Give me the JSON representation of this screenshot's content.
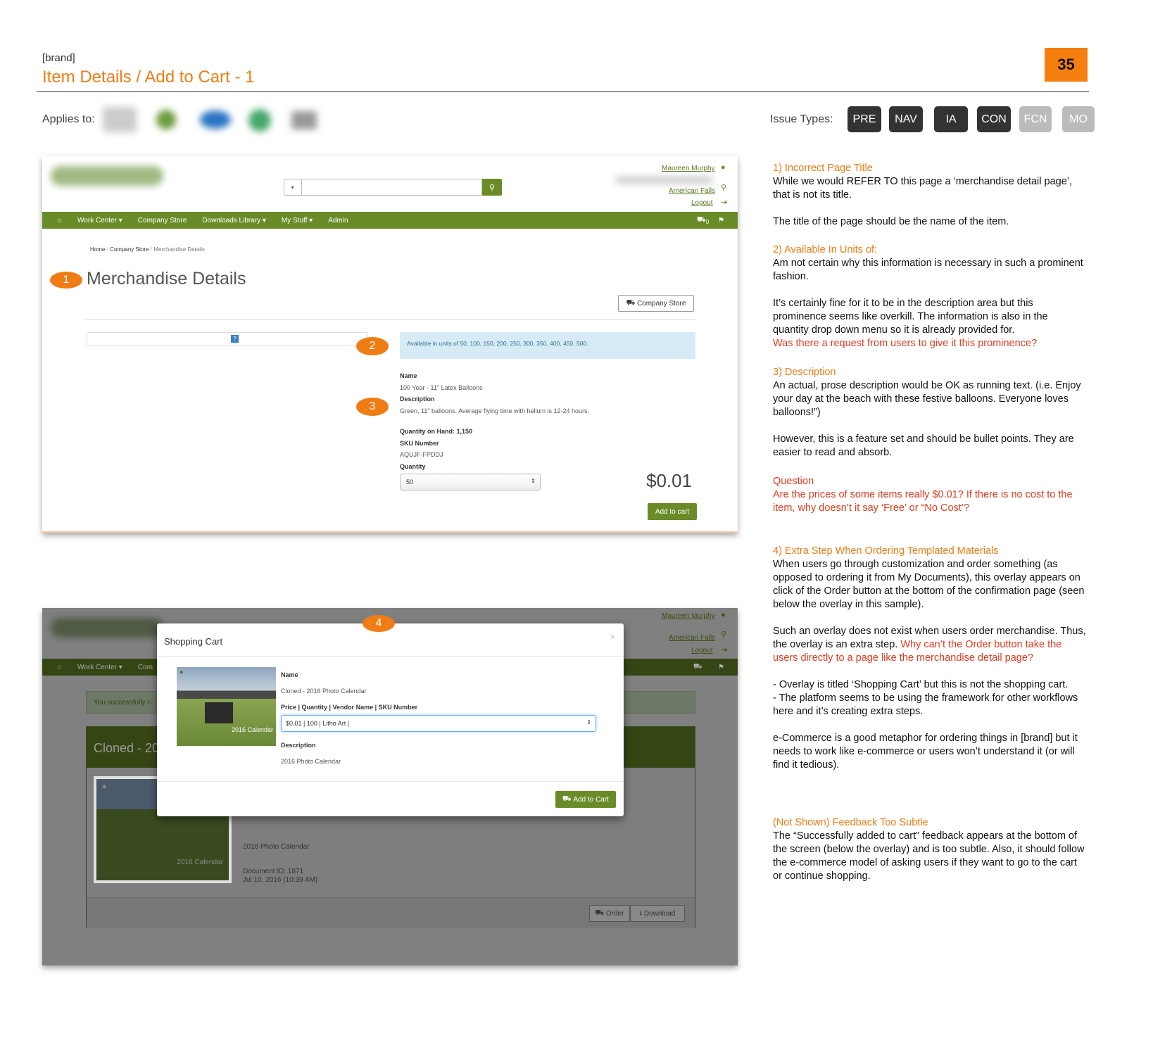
{
  "header": {
    "brand": "[brand]",
    "title": "Item Details / Add to Cart - 1",
    "page_number": "35"
  },
  "applies_to": {
    "label": "Applies to:"
  },
  "issue_types": {
    "label": "Issue Types:",
    "tags": [
      "PRE",
      "NAV",
      "IA",
      "CON",
      "FCN",
      "MO"
    ],
    "active": [
      "PRE",
      "NAV",
      "IA",
      "CON"
    ]
  },
  "shot1": {
    "user_name": "Maureen Murphy",
    "location": "American Falls",
    "logout": "Logout",
    "nav": [
      "Work Center ▾",
      "Company Store",
      "Downloads Library ▾",
      "My Stuff ▾",
      "Admin"
    ],
    "cart_count": "0",
    "breadcrumb": [
      "Home",
      "Company Store",
      "Merchandise Details"
    ],
    "page_heading": "Merchandise Details",
    "company_store_btn": "Company Store",
    "units_notice": "Available in units of 50, 100, 150, 200, 250, 300, 350, 400, 450, 500.",
    "name_label": "Name",
    "name_value": "100 Year - 11\" Latex Balloons",
    "desc_label": "Description",
    "desc_value": "Green, 11\" balloons. Average flying time with helium is 12-24 hours.",
    "qoh": "Quantity on Hand: 1,150",
    "sku_label": "SKU Number",
    "sku_value": "AQUJF-FPDDJ",
    "qty_label": "Quantity",
    "qty_value": "50",
    "price": "$0.01",
    "add_btn": "Add to cart",
    "badges": [
      "1",
      "2",
      "3"
    ]
  },
  "shot2": {
    "user_name": "Maureen Murphy",
    "location": "American Falls",
    "logout": "Logout",
    "nav_visible": [
      "Work Center ▾",
      "Com"
    ],
    "success_text": "You successfully c",
    "panel_title": "Cloned - 20",
    "doc_title": "2016 Photo Calendar",
    "doc_id": "Document ID: 1871",
    "doc_date": "Jul 10, 2016 (10:39 AM)",
    "order_btn": "Order",
    "download_btn": "Download",
    "calendar_caption": "2016 Calendar",
    "badge": "4",
    "modal": {
      "title": "Shopping Cart",
      "close": "×",
      "name_label": "Name",
      "name_value": "Cloned - 2016 Photo Calendar",
      "price_label": "Price | Quantity | Vendor Name | SKU Number",
      "price_value": "$0.01 | 100 | Litho Art |",
      "desc_label": "Description",
      "desc_value": "2016 Photo Calendar",
      "add_btn": "Add to Cart",
      "calendar_caption": "2016 Calendar"
    }
  },
  "notes": {
    "n1_title": "1) Incorrect Page Title",
    "n1_p1": "While we would REFER TO this page a ‘merchandise detail page’, that is not its title.",
    "n1_p2": "The title of the page should be the name of the item.",
    "n2_title": "2) Available In Units of:",
    "n2_p1": "Am not certain why this information is necessary in such a prominent fashion.",
    "n2_p2": "It’s certainly fine for it to be in the description area but this prominence seems like overkill.  The information is also in the quantity drop down menu so it is already provided for.",
    "n2_q": "Was there a request from users to give it this prominence?",
    "n3_title": "3) Description",
    "n3_p1": " An actual, prose description would be OK as running text. (i.e. Enjoy your day at the beach with these festive balloons. Everyone loves balloons!”)",
    "n3_p2": "However, this is a feature set and should be bullet points. They are easier to read and absorb.",
    "q_title": "Question",
    "q_text": "Are the prices of some items really $0.01?  If there is no cost to the item, why doesn’t it say ‘Free’ or “No Cost’?",
    "n4_title": "4) Extra Step When Ordering Templated Materials",
    "n4_p1": "When users go through customization and order something (as opposed to ordering it from My Documents), this overlay appears on click of the Order button at the bottom of the confirmation page (seen below the overlay in this sample).",
    "n4_p2": "Such an overlay does not exist when users order merchandise.  Thus, the overlay is an extra step. ",
    "n4_q": "Why can’t the Order button take the users directly to a page like the merchandise detail page?",
    "n4_p3": "- Overlay is titled ‘Shopping Cart’ but this is not the shopping cart.",
    "n4_p4": "- The platform seems to be using the framework for other workflows here and it’s creating extra steps.",
    "n4_p5": "e-Commerce is a good metaphor for ordering things in [brand] but it needs to work like e-commerce or users won’t understand it (or will find it tedious).",
    "n5_title": "(Not Shown) Feedback Too Subtle",
    "n5_p1": "The “Successfully added to cart” feedback appears at the bottom of the screen (below the overlay) and is too subtle. Also, it should follow the e-commerce model of asking users if they want to go to the cart or continue shopping."
  }
}
